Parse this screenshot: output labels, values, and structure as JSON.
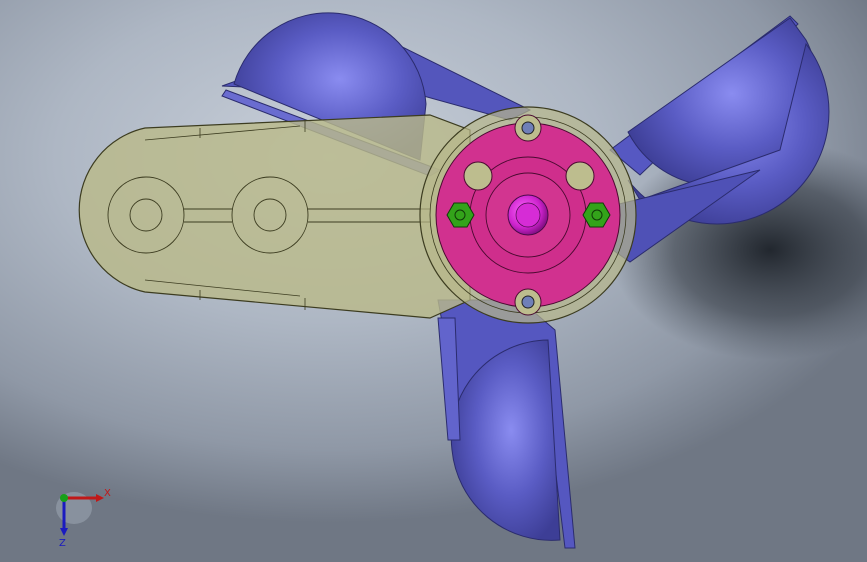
{
  "viewport": {
    "background_top": "#c8cfd9",
    "background_bottom": "#6f7784"
  },
  "model": {
    "arm_color": "#b9b98a",
    "hub_color": "#d1318f",
    "paddle_color": "#5a5cc4",
    "shaft_color": "#cc22cc",
    "nut_color": "#33a31a",
    "hole_color": "#6f7fb8"
  },
  "triad": {
    "x_label": "X",
    "z_label": "Z",
    "x_color": "#c01818",
    "y_color": "#18a018",
    "z_color": "#1a1ac0"
  }
}
